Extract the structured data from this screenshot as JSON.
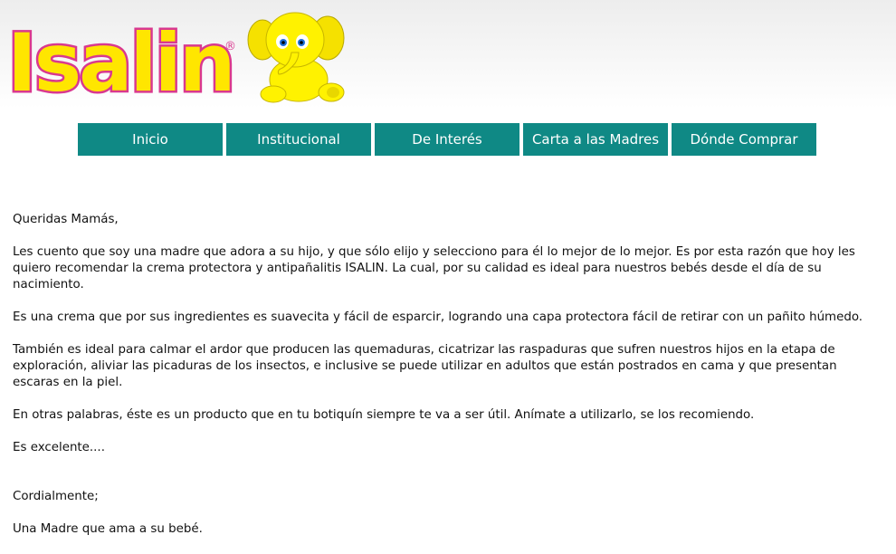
{
  "brand": {
    "name": "ISALIN",
    "logo_text": "Isalin",
    "registered": "®"
  },
  "colors": {
    "nav_bg": "#0f8985",
    "logo_fill": "#ffe600",
    "logo_outline": "#d9388f"
  },
  "nav": {
    "items": [
      {
        "label": "Inicio"
      },
      {
        "label": "Institucional"
      },
      {
        "label": "De Interés"
      },
      {
        "label": "Carta a las Madres"
      },
      {
        "label": "Dónde Comprar"
      }
    ]
  },
  "letter": {
    "greeting": "Queridas Mamás,",
    "paragraphs": [
      "Les cuento que soy una madre que adora a su hijo, y que sólo elijo y selecciono para él lo mejor de lo mejor. Es por esta razón que hoy les quiero recomendar la crema protectora y antipañalitis ISALIN. La cual, por su calidad es ideal para nuestros bebés desde el día de su nacimiento.",
      "Es una crema que por sus ingredientes es suavecita y fácil de esparcir, logrando una capa protectora fácil de retirar con un pañito húmedo.",
      "También es ideal para calmar el ardor que producen las quemaduras, cicatrizar las raspaduras que sufren nuestros hijos en la etapa de exploración, aliviar las picaduras de los insectos, e inclusive se puede utilizar en adultos que están postrados en cama y que presentan escaras en la piel.",
      "En otras palabras, éste es un producto que en tu botiquín siempre te va a ser útil. Anímate a utilizarlo, se los recomiendo.",
      "Es excelente...."
    ],
    "closing": "Cordialmente;",
    "signature": "Una Madre que ama a su bebé."
  }
}
